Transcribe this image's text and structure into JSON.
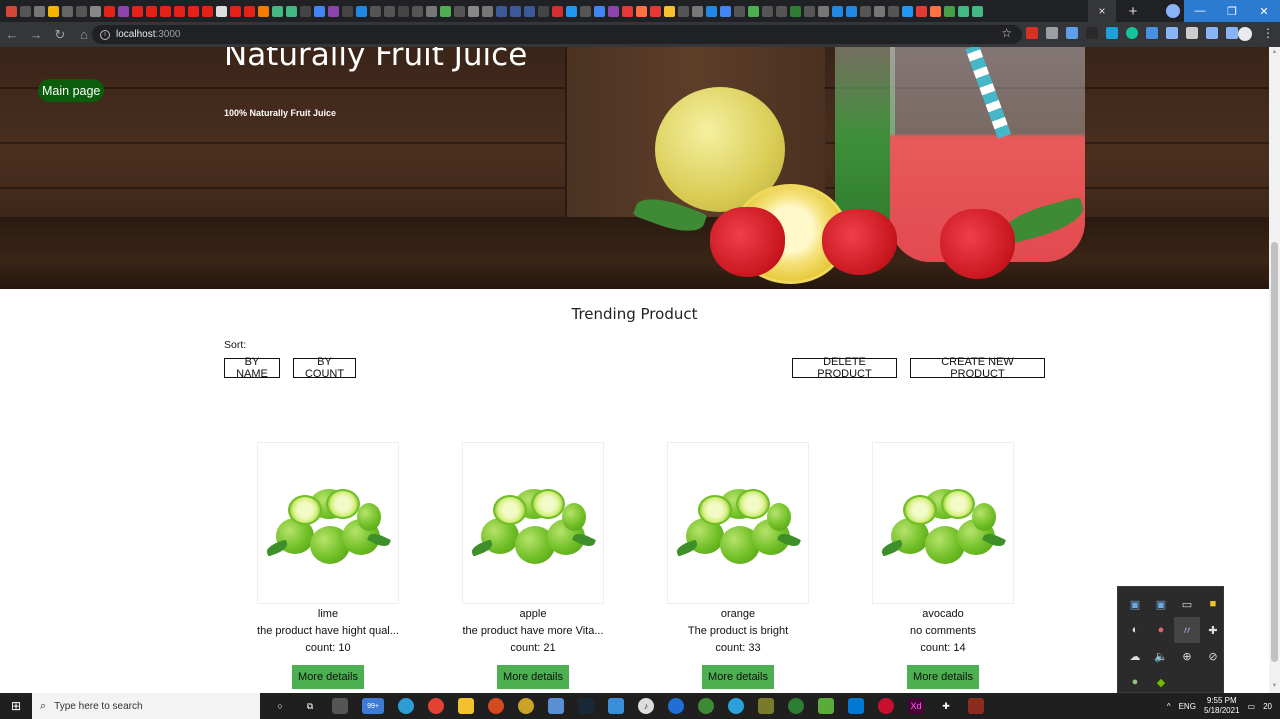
{
  "browser": {
    "url_host": "localhost",
    "url_port": ":3000",
    "tab_close": "×",
    "new_tab": "+"
  },
  "hero": {
    "title": "Naturally Fruit Juice",
    "subtitle": "100% Naturally Fruit Juice",
    "main_page_button": "Main page"
  },
  "section": {
    "title": "Trending Product",
    "sort_label": "Sort:",
    "buttons": {
      "by_name": "BY NAME",
      "by_count": "BY COUNT",
      "delete": "DELETE PRODUCT",
      "create": "CREATE NEW PRODUCT"
    }
  },
  "products": [
    {
      "name": "lime",
      "description": "the product have hight qual...",
      "count": "count: 10",
      "button": "More details"
    },
    {
      "name": "apple",
      "description": "the product have more Vita...",
      "count": "count: 21",
      "button": "More details"
    },
    {
      "name": "orange",
      "description": "The product is bright",
      "count": "count: 33",
      "button": "More details"
    },
    {
      "name": "avocado",
      "description": "no comments",
      "count": "count: 14",
      "button": "More details"
    }
  ],
  "taskbar": {
    "search_placeholder": "Type here to search",
    "language": "ENG",
    "time": "9:55 PM",
    "date": "5/18/2021",
    "notifications": "20",
    "badge": "99+"
  }
}
